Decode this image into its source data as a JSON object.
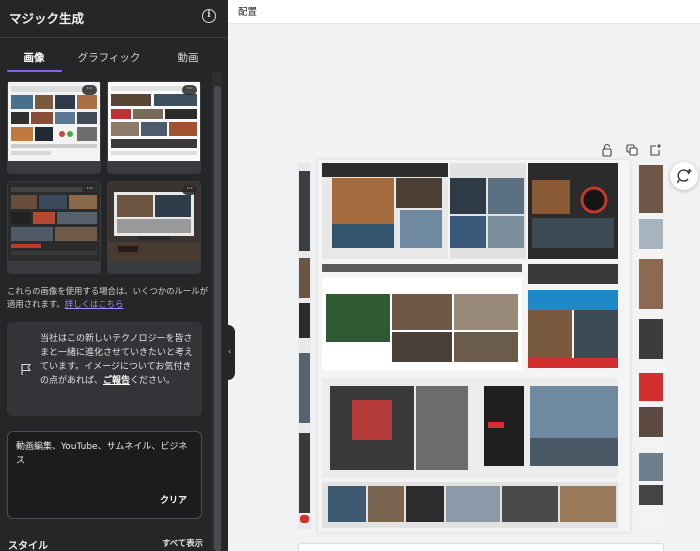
{
  "panel": {
    "title": "マジック生成",
    "info_icon": "info-icon",
    "tabs": [
      {
        "label": "画像",
        "active": true
      },
      {
        "label": "グラフィック",
        "active": false
      },
      {
        "label": "動画",
        "active": false
      }
    ],
    "thumbnails": [
      {
        "more_label": "···"
      },
      {
        "more_label": "···"
      },
      {
        "more_label": "···"
      },
      {
        "more_label": "···"
      }
    ],
    "notice": {
      "text": "これらの画像を使用する場合は、いくつかのルールが適用されます。",
      "link": "詳しくはこちら"
    },
    "feedback": {
      "icon": "flag-icon",
      "text": "当社はこの新しいテクノロジーを皆さまと一緒に進化させていきたいと考えています。イメージについてお気付きの点があれば、",
      "link": "ご報告",
      "suffix": "ください。"
    },
    "prompt": {
      "value": "動画編集、YouTube、サムネイル、ビジネス",
      "clear_label": "クリア"
    },
    "style_label": "スタイル",
    "show_all_label": "すべて表示",
    "accent_color": "#8b5cf6"
  },
  "topbar": {
    "label": "配置"
  },
  "canvas": {
    "tools": [
      "lock-icon",
      "duplicate-icon",
      "add-page-icon"
    ],
    "refresh_icon": "refresh-sparkle-icon"
  }
}
